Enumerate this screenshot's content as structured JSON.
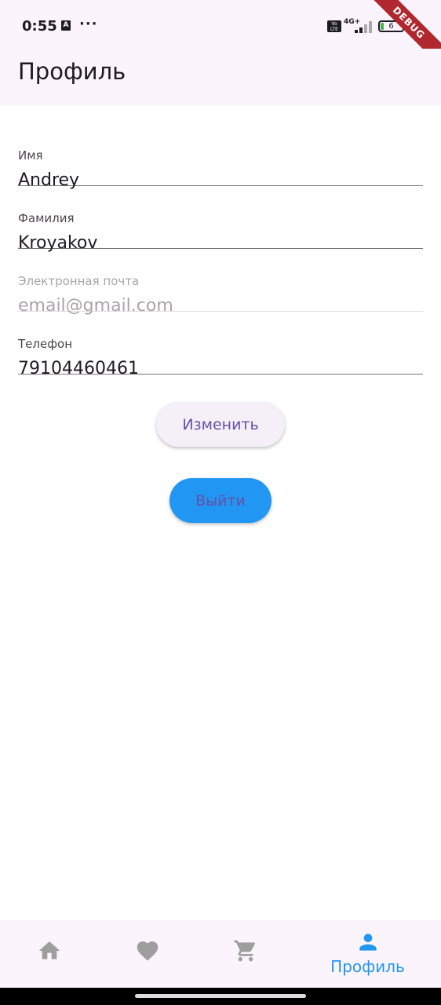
{
  "status_bar": {
    "time": "0:55",
    "notification_icon": "A",
    "more": "···",
    "volte": "Vo LTE",
    "network": "4G+",
    "battery": "6"
  },
  "debug_banner": "DEBUG",
  "app_bar": {
    "title": "Профиль"
  },
  "form": {
    "first_name": {
      "label": "Имя",
      "value": "Andrey"
    },
    "last_name": {
      "label": "Фамилия",
      "value": "Kroyakov"
    },
    "email": {
      "label": "Электронная почта",
      "value": "email@gmail.com"
    },
    "phone": {
      "label": "Телефон",
      "value": "79104460461"
    }
  },
  "buttons": {
    "edit": "Изменить",
    "logout": "Выйти"
  },
  "bottom_nav": {
    "items": [
      {
        "icon": "home-icon"
      },
      {
        "icon": "heart-icon"
      },
      {
        "icon": "cart-icon"
      },
      {
        "icon": "person-icon",
        "label": "Профиль",
        "active": true
      }
    ]
  },
  "colors": {
    "accent": "#2196f3",
    "surface": "#fcf4fc",
    "button_text": "#6750a4",
    "inactive_icon": "#9e9e9e"
  }
}
